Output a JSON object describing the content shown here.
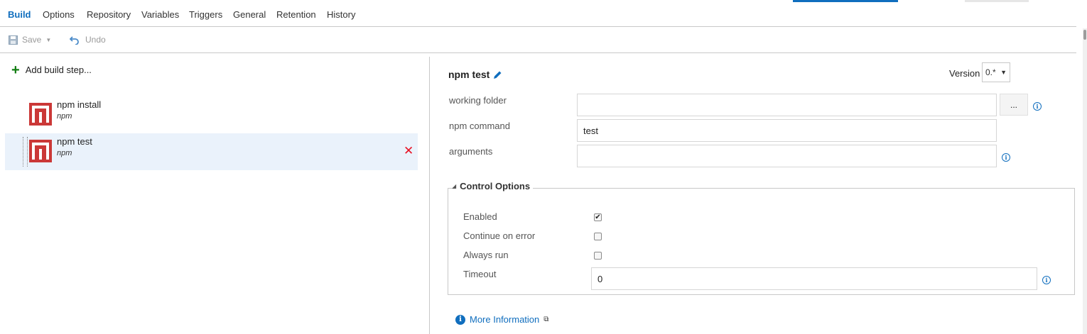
{
  "tabs": [
    {
      "label": "Build",
      "active": true
    },
    {
      "label": "Options",
      "active": false
    },
    {
      "label": "Repository",
      "active": false
    },
    {
      "label": "Variables",
      "active": false
    },
    {
      "label": "Triggers",
      "active": false
    },
    {
      "label": "General",
      "active": false
    },
    {
      "label": "Retention",
      "active": false
    },
    {
      "label": "History",
      "active": false
    }
  ],
  "toolbar": {
    "save_label": "Save",
    "undo_label": "Undo",
    "save_icon": "floppy-disk-icon",
    "undo_icon": "undo-arrow-icon"
  },
  "left_pane": {
    "add_step_label": "Add build step...",
    "tasks": [
      {
        "name": "npm install",
        "type": "npm",
        "selected": false
      },
      {
        "name": "npm test",
        "type": "npm",
        "selected": true
      }
    ]
  },
  "task_editor": {
    "title": "npm test",
    "version_label": "Version",
    "version_value": "0.*",
    "fields": {
      "working_folder": {
        "label": "working folder",
        "value": ""
      },
      "browse_label": "...",
      "npm_command": {
        "label": "npm command",
        "value": "test"
      },
      "arguments": {
        "label": "arguments",
        "value": ""
      }
    },
    "control_options": {
      "title": "Control Options",
      "enabled": {
        "label": "Enabled",
        "checked": true
      },
      "continue_on_error": {
        "label": "Continue on error",
        "checked": false
      },
      "always_run": {
        "label": "Always run",
        "checked": false
      },
      "timeout": {
        "label": "Timeout",
        "value": "0"
      }
    },
    "more_info_label": "More Information"
  },
  "colors": {
    "accent": "#106ebe",
    "npm_red": "#cb3837",
    "delete_red": "#e81123",
    "add_green": "#107c10",
    "selected_row": "#eaf2fb"
  }
}
